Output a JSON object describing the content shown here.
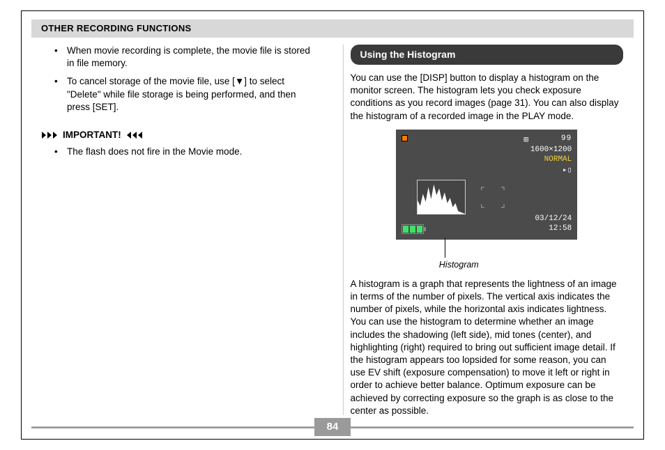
{
  "header": {
    "title": "OTHER RECORDING FUNCTIONS"
  },
  "left": {
    "bullets": [
      "When movie recording is complete, the movie file is stored in file memory.",
      "To cancel storage of the movie file, use [▼] to select \"Delete\" while file storage is being performed, and then press [SET]."
    ],
    "important_label": "IMPORTANT!",
    "important_bullets": [
      "The flash does not fire in the Movie mode."
    ]
  },
  "right": {
    "section_title": "Using the Histogram",
    "para1": "You can use the [DISP] button to display a histogram on the monitor screen. The histogram lets you check exposure conditions as you record images (page 31). You can also display the histogram of a recorded image in the PLAY mode.",
    "lcd": {
      "shots": "99",
      "resolution": "1600×1200",
      "quality": "NORMAL",
      "date": "03/12/24",
      "time": "12:58",
      "caption": "Histogram"
    },
    "para2": "A histogram is a graph that represents the lightness of an image in terms of the number of pixels. The vertical axis indicates the number of pixels, while the horizontal axis indicates lightness. You can use the histogram to determine whether an image includes the shadowing (left side), mid tones (center), and highlighting (right) required to bring out sufficient image detail. If the histogram appears too lopsided for some reason, you can use EV shift (exposure compensation) to move it left or right in order to achieve better balance. Optimum exposure can be achieved by correcting exposure so the graph is as close to the center as possible."
  },
  "footer": {
    "page": "84"
  }
}
